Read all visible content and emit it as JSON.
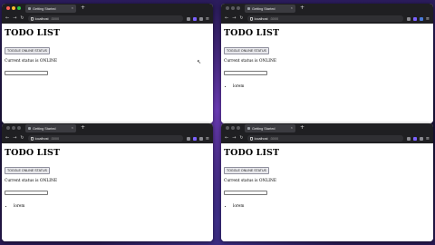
{
  "browser": {
    "tab_title": "Getting Started",
    "url_host": "localhost",
    "url_port": ":3000",
    "new_tab_symbol": "+",
    "tab_close_symbol": "×",
    "back_symbol": "←",
    "forward_symbol": "→",
    "reload_symbol": "↻",
    "menu_symbol": "≡"
  },
  "app": {
    "heading": "TODO LIST",
    "toggle_label": "TOGGLE ONLINE STATUS",
    "status_text": "Current status is ONLINE",
    "input_value": ""
  },
  "windows": [
    {
      "id": "top-left",
      "items": []
    },
    {
      "id": "top-right",
      "items": [
        "lorem"
      ]
    },
    {
      "id": "bottom-left",
      "items": [
        "lorem"
      ]
    },
    {
      "id": "bottom-right",
      "items": [
        "lorem"
      ]
    }
  ],
  "colors": {
    "chrome": "#1f1f22",
    "tab": "#3b3b40",
    "desktop": "#2b1c5c",
    "accent_ext": "#7b61ff"
  }
}
